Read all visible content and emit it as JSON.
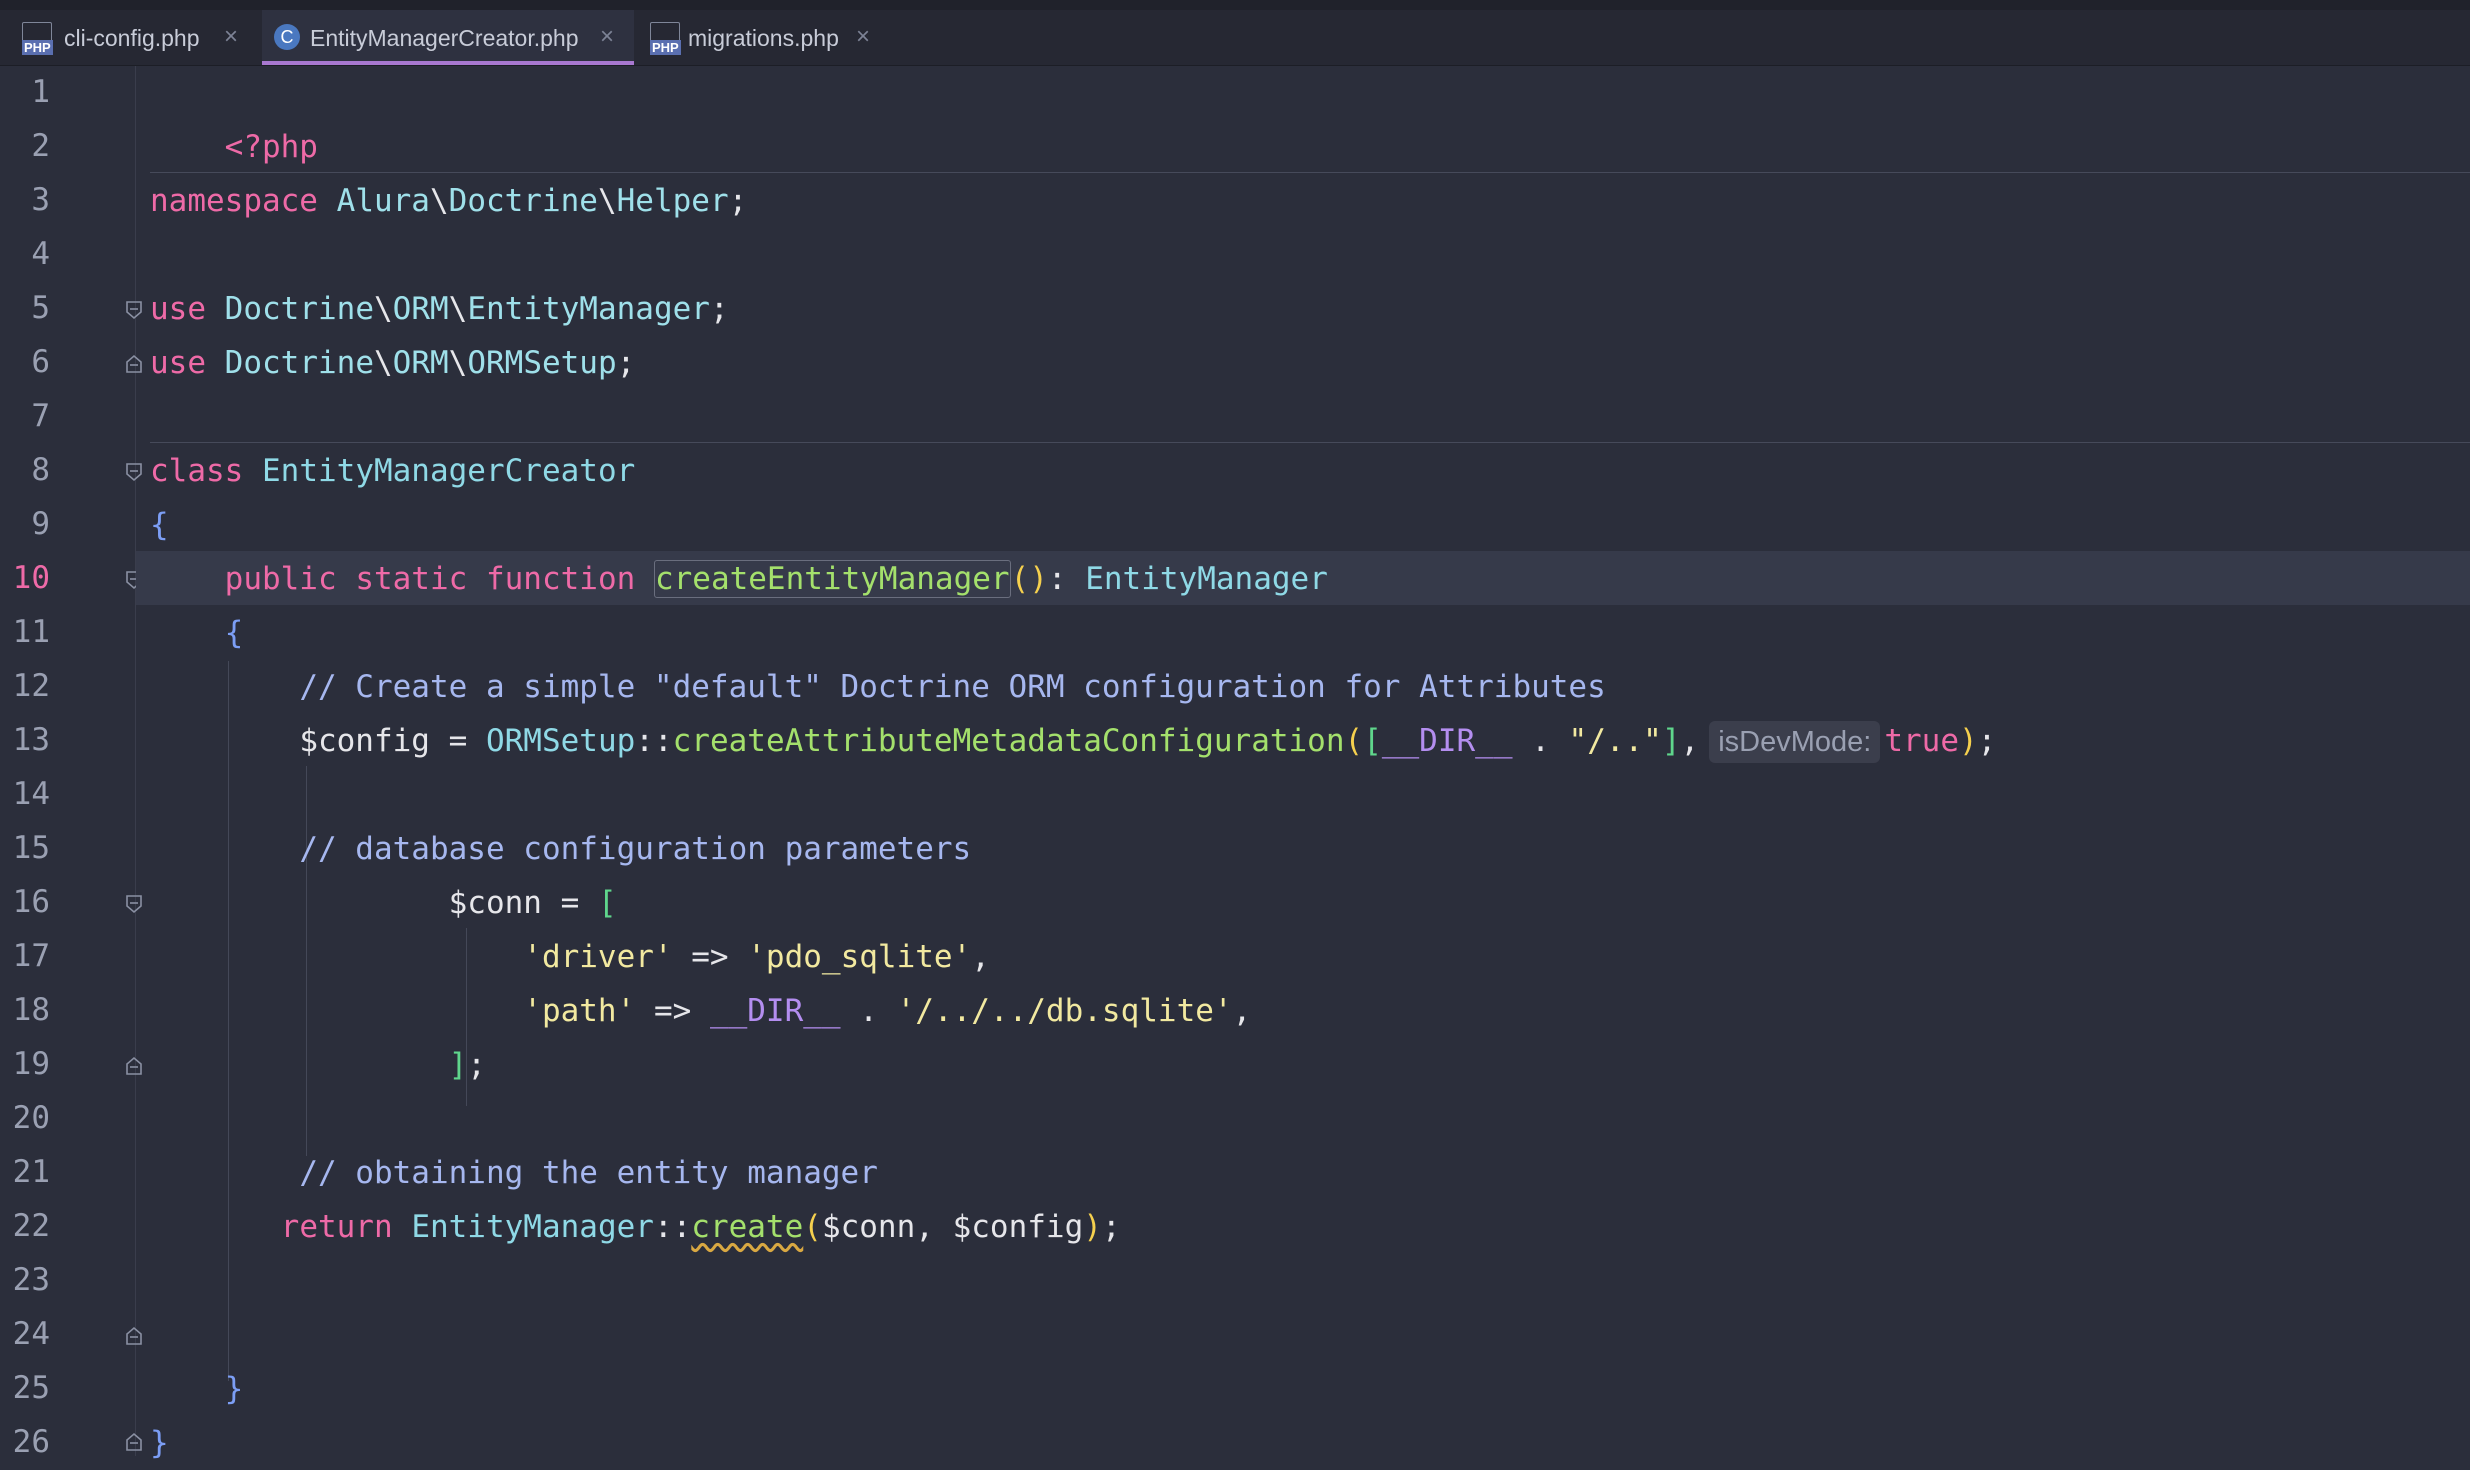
{
  "tabs": [
    {
      "label": "cli-config.php",
      "icon": "php-file-icon",
      "active": false
    },
    {
      "label": "EntityManagerCreator.php",
      "icon": "class-file-icon",
      "active": true
    },
    {
      "label": "migrations.php",
      "icon": "php-file-icon",
      "active": false
    }
  ],
  "tab_close_glyph": "×",
  "file_type_badge": "PHP",
  "class_badge": "C",
  "current_line": 10,
  "line_numbers": [
    "1",
    "2",
    "3",
    "4",
    "5",
    "6",
    "7",
    "8",
    "9",
    "10",
    "11",
    "12",
    "13",
    "14",
    "15",
    "16",
    "17",
    "18",
    "19",
    "20",
    "21",
    "22",
    "23",
    "24",
    "25",
    "26"
  ],
  "code": {
    "l1": {
      "open": "<?php"
    },
    "l3": {
      "kw": "namespace",
      "ns1": "Alura",
      "sep1": "\\",
      "ns2": "Doctrine",
      "sep2": "\\",
      "ns3": "Helper",
      "end": ";"
    },
    "l5": {
      "kw": "use",
      "a": "Doctrine",
      "s1": "\\",
      "b": "ORM",
      "s2": "\\",
      "c": "EntityManager",
      "end": ";"
    },
    "l6": {
      "kw": "use",
      "a": "Doctrine",
      "s1": "\\",
      "b": "ORM",
      "s2": "\\",
      "c": "ORMSetup",
      "end": ";"
    },
    "l8": {
      "kw": "class",
      "name": "EntityManagerCreator"
    },
    "l9": {
      "brace": "{"
    },
    "l10": {
      "kw1": "public",
      "kw2": "static",
      "kw3": "function",
      "fn": "createEntityManager",
      "parens": "()",
      "colon": ":",
      "type": "EntityManager"
    },
    "l11": {
      "brace": "{"
    },
    "l12": {
      "comment": "// Create a simple \"default\" Doctrine ORM configuration for Attributes"
    },
    "l13": {
      "var": "$config",
      "eq": "=",
      "cls": "ORMSetup",
      "dc": "::",
      "fn": "createAttributeMetadataConfiguration",
      "po": "(",
      "bo": "[",
      "const": "__DIR__",
      "dot": ".",
      "str": "\"/..\"",
      "bc": "]",
      "comma": ",",
      "hint": "isDevMode:",
      "val": "true",
      "pc": ")",
      "end": ";"
    },
    "l15": {
      "comment": "// database configuration parameters"
    },
    "l16": {
      "var": "$conn",
      "eq": "=",
      "bo": "["
    },
    "l17": {
      "key": "'driver'",
      "arrow": "=>",
      "val": "'pdo_sqlite'",
      "comma": ","
    },
    "l18": {
      "key": "'path'",
      "arrow": "=>",
      "const": "__DIR__",
      "dot": ".",
      "val": "'/../../db.sqlite'",
      "comma": ","
    },
    "l19": {
      "bc": "]",
      "end": ";"
    },
    "l21": {
      "comment": "// obtaining the entity manager"
    },
    "l22": {
      "kw": "return",
      "cls": "EntityManager",
      "dc": "::",
      "fn": "create",
      "po": "(",
      "a1": "$conn",
      "comma": ",",
      "a2": "$config",
      "pc": ")",
      "end": ";"
    },
    "l24": {
      "brace": "}"
    },
    "l26": {
      "brace": "}"
    }
  }
}
